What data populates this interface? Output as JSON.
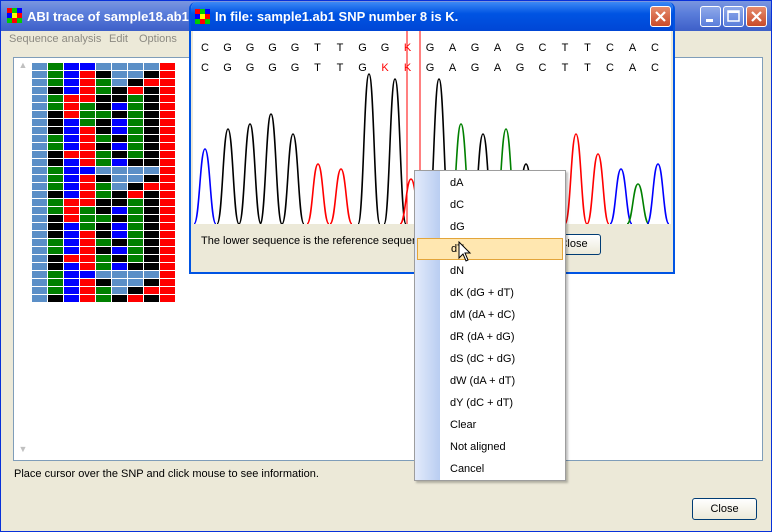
{
  "main_window": {
    "title": "ABI trace of sample18.ab1",
    "menu": [
      "Sequence analysis",
      "Edit",
      "Options"
    ],
    "status_text": "Place cursor over the SNP and click mouse to see information.",
    "close_label": "Close"
  },
  "dialog": {
    "title": "In file: sample1.ab1  SNP number 8 is K.",
    "sequence_top": [
      "C",
      "G",
      "G",
      "G",
      "G",
      "T",
      "T",
      "G",
      "G",
      "K",
      "G",
      "A",
      "G",
      "A",
      "G",
      "C",
      "T",
      "T",
      "C",
      "A",
      "C"
    ],
    "sequence_bottom": [
      "C",
      "G",
      "G",
      "G",
      "G",
      "T",
      "T",
      "G",
      "K",
      "K",
      "G",
      "A",
      "G",
      "A",
      "G",
      "C",
      "T",
      "T",
      "C",
      "A",
      "C"
    ],
    "message": "The lower sequence is the reference sequence.",
    "close_label": "Close"
  },
  "context_menu": {
    "items": [
      "dA",
      "dC",
      "dG",
      "dT",
      "dN",
      "dK (dG + dT)",
      "dM (dA + dC)",
      "dR (dA + dG)",
      "dS (dC + dG)",
      "dW (dA + dT)",
      "dY (dC + dT)",
      "Clear",
      "Not aligned",
      "Cancel"
    ],
    "hovered_index": 3
  },
  "colors": {
    "A": "#008000",
    "C": "#0000ff",
    "G": "#000000",
    "T": "#ff0000",
    "snp_marker": "#ff0000"
  }
}
